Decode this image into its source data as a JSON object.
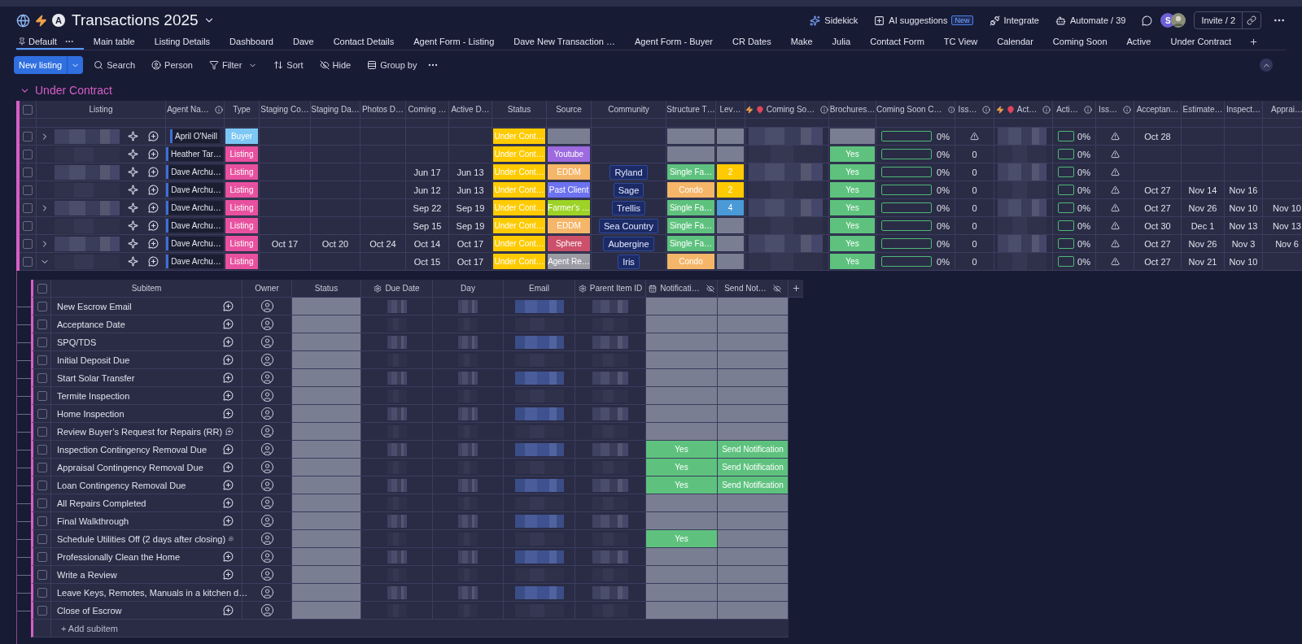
{
  "board": {
    "badge": "A",
    "title": "Transactions 2025"
  },
  "header_actions": [
    {
      "kind": "sidekick",
      "label": "Sidekick"
    },
    {
      "kind": "ai",
      "label": "AI suggestions",
      "badge": "New"
    },
    {
      "kind": "integrate",
      "label": "Integrate"
    },
    {
      "kind": "automate",
      "label": "Automate / 39"
    }
  ],
  "avatar_initial": "S",
  "invite": "Invite / 2",
  "tabs": [
    {
      "label": "Default",
      "selected": true,
      "pinned": true
    },
    {
      "label": "Main table",
      "selected": false,
      "pinned": false
    },
    {
      "label": "Listing Details",
      "selected": false,
      "pinned": false
    },
    {
      "label": "Dashboard",
      "selected": false,
      "pinned": false
    },
    {
      "label": "Dave",
      "selected": false,
      "pinned": false
    },
    {
      "label": "Contact Details",
      "selected": false,
      "pinned": false
    },
    {
      "label": "Agent Form - Listing",
      "selected": false,
      "pinned": false
    },
    {
      "label": "Dave New Transaction …",
      "selected": false,
      "pinned": false
    },
    {
      "label": "Agent Form - Buyer",
      "selected": false,
      "pinned": false
    },
    {
      "label": "CR Dates",
      "selected": false,
      "pinned": false
    },
    {
      "label": "Make",
      "selected": false,
      "pinned": false
    },
    {
      "label": "Julia",
      "selected": false,
      "pinned": false
    },
    {
      "label": "Contact Form",
      "selected": false,
      "pinned": false
    },
    {
      "label": "TC View",
      "selected": false,
      "pinned": false
    },
    {
      "label": "Calendar",
      "selected": false,
      "pinned": false
    },
    {
      "label": "Coming Soon",
      "selected": false,
      "pinned": false
    },
    {
      "label": "Active",
      "selected": false,
      "pinned": false
    },
    {
      "label": "Under Contract",
      "selected": false,
      "pinned": false
    }
  ],
  "toolbar": {
    "primary": "New listing",
    "tools": [
      {
        "kind": "search",
        "label": "Search",
        "dropdown": false
      },
      {
        "kind": "person",
        "label": "Person",
        "dropdown": false
      },
      {
        "kind": "filter",
        "label": "Filter",
        "dropdown": true
      },
      {
        "kind": "sort",
        "label": "Sort",
        "dropdown": false
      },
      {
        "kind": "hide",
        "label": "Hide",
        "dropdown": false
      },
      {
        "kind": "group",
        "label": "Group by",
        "dropdown": false
      }
    ]
  },
  "group": {
    "title": "Under Contract",
    "expanded": true
  },
  "table": {
    "all_checked": false,
    "columns": [
      {
        "label": "Listing",
        "kind": "listing"
      },
      {
        "label": "Agent Na…",
        "kind": "agent",
        "info": true
      },
      {
        "label": "Type",
        "kind": "label"
      },
      {
        "label": "Staging Co…",
        "kind": "date"
      },
      {
        "label": "Staging Da…",
        "kind": "date"
      },
      {
        "label": "Photos D…",
        "kind": "date"
      },
      {
        "label": "Coming …",
        "kind": "date"
      },
      {
        "label": "Active D…",
        "kind": "date"
      },
      {
        "label": "Status",
        "kind": "label"
      },
      {
        "label": "Source",
        "kind": "label"
      },
      {
        "label": "Community",
        "kind": "tag"
      },
      {
        "label": "Structure T…",
        "kind": "label"
      },
      {
        "label": "Lev…",
        "kind": "label"
      },
      {
        "label": "Coming So…",
        "kind": "blur",
        "info": true,
        "automated": true
      },
      {
        "label": "Brochures…",
        "kind": "label"
      },
      {
        "label": "Coming Soon C…",
        "kind": "progress",
        "info": true
      },
      {
        "label": "Iss…",
        "kind": "issue",
        "info": true
      },
      {
        "label": "Act…",
        "kind": "blur",
        "info": true,
        "automated": true
      },
      {
        "label": "Acti…",
        "kind": "progress",
        "info": true
      },
      {
        "label": "Iss…",
        "kind": "issue",
        "info": true
      },
      {
        "label": "Acceptan…",
        "kind": "date"
      },
      {
        "label": "Estimate…",
        "kind": "date"
      },
      {
        "label": "Inspect…",
        "kind": "date"
      },
      {
        "label": "Apprai…",
        "kind": "date"
      }
    ],
    "rows": [
      {
        "checked": false,
        "has_subitems": true,
        "expanded": false,
        "cells": [
          null,
          "April O'Neill",
          {
            "text": "Buyer",
            "color": "#7cc7f5"
          },
          null,
          null,
          null,
          null,
          null,
          {
            "text": "Under Cont…",
            "color": "#ffcb00"
          },
          null,
          null,
          null,
          null,
          null,
          null,
          {
            "text": "0%",
            "level": 0
          },
          {
            "kind": "warning"
          },
          null,
          {
            "text": "0%",
            "level": 0
          },
          {
            "kind": "warning"
          },
          "Oct 28",
          null,
          null,
          null
        ]
      },
      {
        "checked": false,
        "has_subitems": false,
        "cells": [
          null,
          "Heather Tar…",
          {
            "text": "Listing",
            "color": "#e8519f"
          },
          null,
          null,
          null,
          null,
          null,
          {
            "text": "Under Cont…",
            "color": "#ffcb00"
          },
          {
            "text": "Youtube",
            "color": "#9d6ae0"
          },
          null,
          null,
          null,
          null,
          {
            "text": "Yes",
            "color": "#5ec27e"
          },
          {
            "text": "0%",
            "level": 0
          },
          {
            "kind": "count",
            "text": "0"
          },
          null,
          {
            "text": "0%",
            "level": 0
          },
          {
            "kind": "warning"
          },
          null,
          null,
          null,
          null
        ]
      },
      {
        "checked": false,
        "has_subitems": false,
        "cells": [
          null,
          "Dave Archu…",
          {
            "text": "Listing",
            "color": "#e8519f"
          },
          null,
          null,
          null,
          "Jun 17",
          "Jun 13",
          {
            "text": "Under Cont…",
            "color": "#ffcb00"
          },
          {
            "text": "EDDM",
            "color": "#f5b66a"
          },
          "Ryland",
          {
            "text": "Single Fa…",
            "color": "#5ec27e"
          },
          {
            "text": "2",
            "color": "#ffcb00"
          },
          null,
          {
            "text": "Yes",
            "color": "#5ec27e"
          },
          {
            "text": "0%",
            "level": 0
          },
          {
            "kind": "count",
            "text": "0"
          },
          null,
          {
            "text": "0%",
            "level": 0
          },
          {
            "kind": "warning"
          },
          null,
          null,
          null,
          null
        ]
      },
      {
        "checked": false,
        "has_subitems": false,
        "cells": [
          null,
          "Dave Archu…",
          {
            "text": "Listing",
            "color": "#e8519f"
          },
          null,
          null,
          null,
          "Jun 12",
          "Jun 13",
          {
            "text": "Under Cont…",
            "color": "#ffcb00"
          },
          {
            "text": "Past Client",
            "color": "#6d72f0"
          },
          "Sage",
          {
            "text": "Condo",
            "color": "#f5b66a"
          },
          {
            "text": "2",
            "color": "#ffcb00"
          },
          null,
          {
            "text": "Yes",
            "color": "#5ec27e"
          },
          {
            "text": "0%",
            "level": 0
          },
          {
            "kind": "count",
            "text": "0"
          },
          null,
          {
            "text": "0%",
            "level": 0
          },
          {
            "kind": "warning"
          },
          "Oct 27",
          "Nov 14",
          "Nov 16",
          null
        ]
      },
      {
        "checked": false,
        "has_subitems": true,
        "expanded": false,
        "cells": [
          null,
          "Dave Archu…",
          {
            "text": "Listing",
            "color": "#e8519f"
          },
          null,
          null,
          null,
          "Sep 22",
          "Sep 19",
          {
            "text": "Under Cont…",
            "color": "#ffcb00"
          },
          {
            "text": "Farmer's …",
            "color": "#9cd326"
          },
          "Trellis",
          {
            "text": "Single Fa…",
            "color": "#5ec27e"
          },
          {
            "text": "4",
            "color": "#4a9ad8"
          },
          null,
          {
            "text": "Yes",
            "color": "#5ec27e"
          },
          {
            "text": "0%",
            "level": 0
          },
          {
            "kind": "count",
            "text": "0"
          },
          null,
          {
            "text": "0%",
            "level": 0
          },
          {
            "kind": "warning"
          },
          "Oct 27",
          "Nov 26",
          "Nov 10",
          "Nov 10"
        ]
      },
      {
        "checked": false,
        "has_subitems": false,
        "cells": [
          null,
          "Dave Archu…",
          {
            "text": "Listing",
            "color": "#e8519f"
          },
          null,
          null,
          null,
          "Sep 15",
          "Sep 19",
          {
            "text": "Under Cont…",
            "color": "#ffcb00"
          },
          {
            "text": "EDDM",
            "color": "#f5b66a"
          },
          "Sea Country",
          {
            "text": "Single Fa…",
            "color": "#5ec27e"
          },
          null,
          null,
          {
            "text": "Yes",
            "color": "#5ec27e"
          },
          {
            "text": "0%",
            "level": 0
          },
          {
            "kind": "count",
            "text": "0"
          },
          null,
          {
            "text": "0%",
            "level": 0
          },
          {
            "kind": "warning"
          },
          "Oct 30",
          "Dec 1",
          "Nov 13",
          "Nov 13"
        ]
      },
      {
        "checked": false,
        "has_subitems": true,
        "expanded": false,
        "cells": [
          null,
          "Dave Archu…",
          {
            "text": "Listing",
            "color": "#e8519f"
          },
          "Oct 17",
          "Oct 20",
          "Oct 24",
          "Oct 14",
          "Oct 17",
          {
            "text": "Under Cont…",
            "color": "#ffcb00"
          },
          {
            "text": "Sphere",
            "color": "#cc5069"
          },
          "Aubergine",
          {
            "text": "Single Fa…",
            "color": "#5ec27e"
          },
          null,
          null,
          {
            "text": "Yes",
            "color": "#5ec27e"
          },
          {
            "text": "0%",
            "level": 0
          },
          {
            "kind": "count",
            "text": "0"
          },
          null,
          {
            "text": "0%",
            "level": 0
          },
          {
            "kind": "warning"
          },
          "Oct 27",
          "Nov 26",
          "Nov 3",
          "Nov 6"
        ]
      },
      {
        "checked": false,
        "has_subitems": true,
        "expanded": true,
        "cells": [
          null,
          "Dave Archu…",
          {
            "text": "Listing",
            "color": "#e8519f"
          },
          null,
          null,
          null,
          "Oct 15",
          "Oct 17",
          {
            "text": "Under Cont…",
            "color": "#ffcb00"
          },
          {
            "text": "Agent Re…",
            "color": "#9a9ba3"
          },
          "Iris",
          {
            "text": "Condo",
            "color": "#f5b66a"
          },
          null,
          null,
          {
            "text": "Yes",
            "color": "#5ec27e"
          },
          {
            "text": "0%",
            "level": 0
          },
          {
            "kind": "count",
            "text": "0"
          },
          null,
          {
            "text": "0%",
            "level": 0
          },
          {
            "kind": "warning"
          },
          "Oct 27",
          "Nov 21",
          "Nov 10",
          null
        ]
      }
    ]
  },
  "subitems": {
    "columns": [
      {
        "label": "Subitem",
        "kind": "name"
      },
      {
        "label": "Owner",
        "kind": "owner"
      },
      {
        "label": "Status",
        "kind": "status"
      },
      {
        "label": "Due Date",
        "kind": "blur"
      },
      {
        "label": "Day",
        "kind": "blur"
      },
      {
        "label": "Email",
        "kind": "blur"
      },
      {
        "label": "Parent Item ID",
        "kind": "blur"
      },
      {
        "label": "Notificati…",
        "kind": "notification",
        "hidden": true
      },
      {
        "label": "Send Not…",
        "kind": "send",
        "hidden": true
      }
    ],
    "all_checked": false,
    "rows": [
      {
        "checked": false,
        "name": "New Escrow Email",
        "notification": null,
        "send": null
      },
      {
        "checked": false,
        "name": "Acceptance Date",
        "notification": null,
        "send": null
      },
      {
        "checked": false,
        "name": "SPQ/TDS",
        "notification": null,
        "send": null
      },
      {
        "checked": false,
        "name": "Initial Deposit Due",
        "notification": null,
        "send": null
      },
      {
        "checked": false,
        "name": "Start Solar Transfer",
        "notification": null,
        "send": null
      },
      {
        "checked": false,
        "name": "Termite Inspection",
        "notification": null,
        "send": null
      },
      {
        "checked": false,
        "name": "Home Inspection",
        "notification": null,
        "send": null
      },
      {
        "checked": false,
        "name": "Review Buyer’s Request for Repairs (RR)",
        "notification": null,
        "send": null
      },
      {
        "checked": false,
        "name": "Inspection Contingency Removal Due",
        "notification": {
          "text": "Yes",
          "color": "#5ec27e"
        },
        "send": {
          "text": "Send Notification",
          "color": "#5ec27e"
        }
      },
      {
        "checked": false,
        "name": "Appraisal Contingency Removal Due",
        "notification": {
          "text": "Yes",
          "color": "#5ec27e"
        },
        "send": {
          "text": "Send Notification",
          "color": "#5ec27e"
        }
      },
      {
        "checked": false,
        "name": "Loan Contingency Removal Due",
        "notification": {
          "text": "Yes",
          "color": "#5ec27e"
        },
        "send": {
          "text": "Send Notification",
          "color": "#5ec27e"
        }
      },
      {
        "checked": false,
        "name": "All Repairs Completed",
        "notification": null,
        "send": null
      },
      {
        "checked": false,
        "name": "Final Walkthrough",
        "notification": null,
        "send": null
      },
      {
        "checked": false,
        "name": "Schedule Utilities Off (2 days after closing)",
        "notification": {
          "text": "Yes",
          "color": "#5ec27e"
        },
        "send": null
      },
      {
        "checked": false,
        "name": "Professionally Clean the Home",
        "notification": null,
        "send": null
      },
      {
        "checked": false,
        "name": "Write a Review",
        "notification": null,
        "send": null
      },
      {
        "checked": false,
        "name": "Leave Keys, Remotes, Manuals in a kitchen d…",
        "notification": null,
        "send": null
      },
      {
        "checked": false,
        "name": "Close of Escrow",
        "notification": null,
        "send": null
      }
    ],
    "add": "+ Add subitem"
  }
}
